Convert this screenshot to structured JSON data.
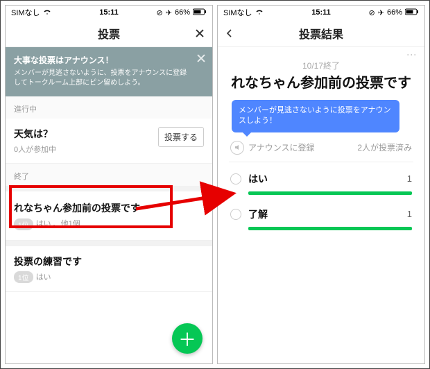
{
  "statusbar": {
    "carrier": "SIMなし",
    "time": "15:11",
    "battery": "66%"
  },
  "left": {
    "title": "投票",
    "banner": {
      "title": "大事な投票はアナウンス！",
      "body": "メンバーが見逃さないように、投票をアナウンスに登録してトークルーム上部にピン留めしよう。"
    },
    "section_in_progress": "進行中",
    "poll_in_progress": {
      "title": "天気は？",
      "sub": "0人が参加中",
      "action": "投票する"
    },
    "section_done": "終了",
    "poll_done_1": {
      "title": "れなちゃん参加前の投票です",
      "rank": "1位",
      "sub": "はい 、他1個"
    },
    "poll_done_2": {
      "title": "投票の練習です",
      "rank": "1位",
      "sub": "はい"
    }
  },
  "right": {
    "title": "投票結果",
    "end_date": "10/17終了",
    "poll_title": "れなちゃん参加前の投票です",
    "bubble": "メンバーが見逃さないように投票をアナウンスしよう！",
    "announce_label": "アナウンスに登録",
    "voted_label": "2人が投票済み",
    "options": [
      {
        "label": "はい",
        "count": "1"
      },
      {
        "label": "了解",
        "count": "1"
      }
    ]
  }
}
